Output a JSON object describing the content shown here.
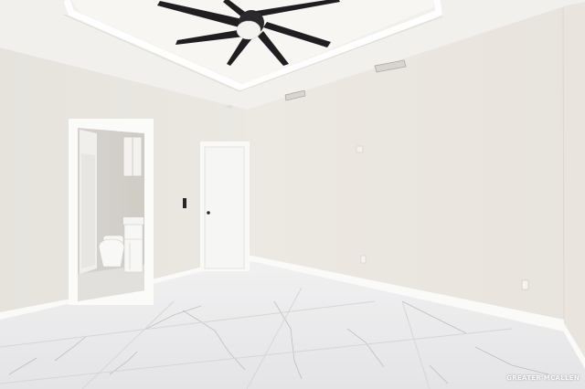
{
  "photo": {
    "alt": "",
    "watermark": "GREATER MCALLEN"
  },
  "colors": {
    "wall": "#edeae4",
    "wall_right": "#ebe7e1",
    "ceiling": "#f1efeb",
    "floor": "#e9e9ea",
    "fan_blade": "#1f1f22",
    "trim": "#fbfbfa"
  }
}
